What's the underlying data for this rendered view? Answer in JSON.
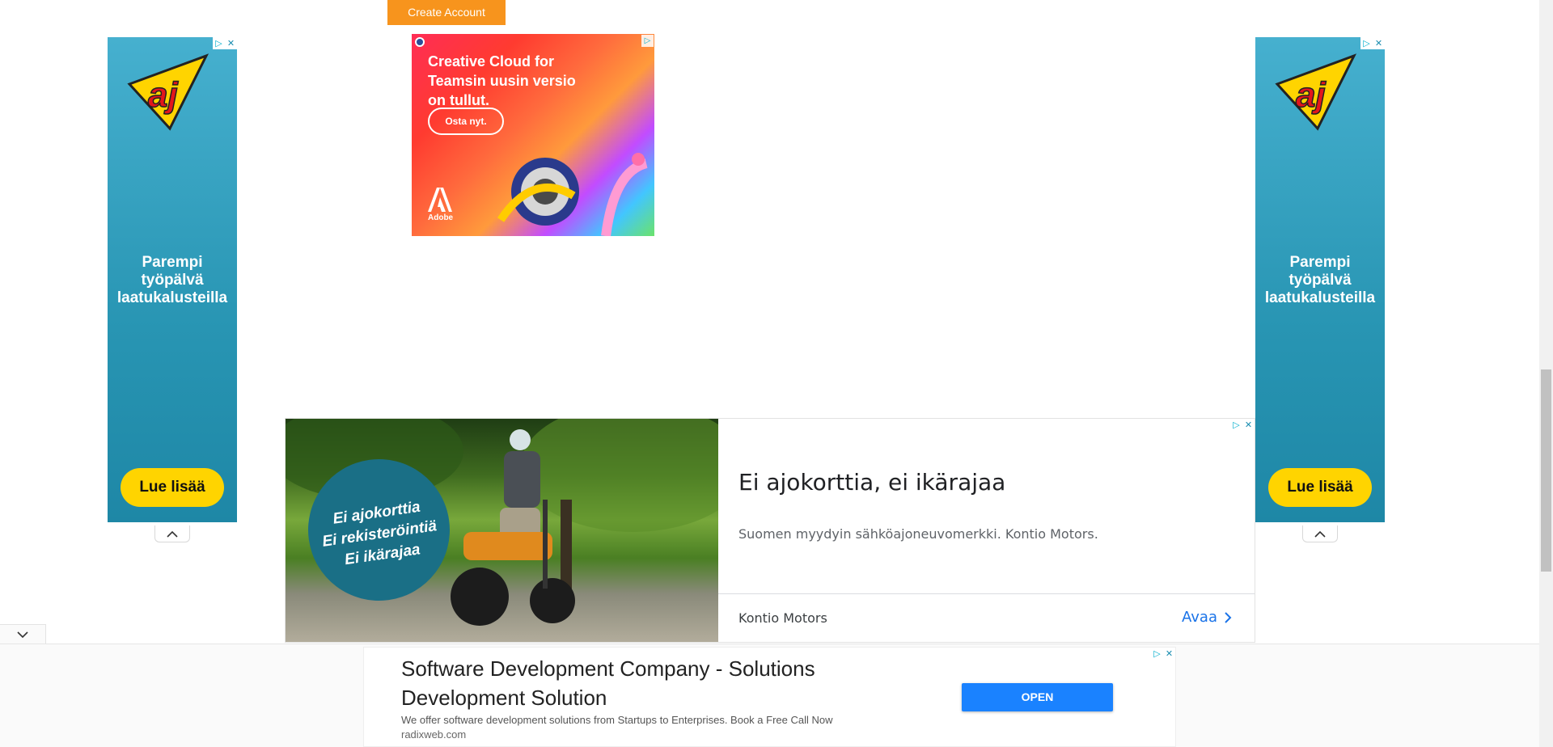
{
  "header": {
    "create_account_label": "Create Account"
  },
  "side_ads": {
    "tagline_line1": "Parempi",
    "tagline_line2": "työpälvä",
    "tagline_line3": "laatukalusteilla",
    "cta_label": "Lue lisää",
    "logo_text": "aj"
  },
  "adobe_ad": {
    "headline": "Creative Cloud for Teamsin uusin versio on tullut.",
    "cta_label": "Osta nyt.",
    "brand": "Adobe"
  },
  "kontio_ad": {
    "badge_line1": "Ei ajokorttia",
    "badge_line2": "Ei rekisteröintiä",
    "badge_line3": "Ei ikärajaa",
    "headline": "Ei ajokorttia, ei ikärajaa",
    "description": "Suomen myydyin sähköajoneuvomerkki. Kontio Motors.",
    "advertiser": "Kontio Motors",
    "open_label": "Avaa"
  },
  "bottom_ad": {
    "headline": "Software Development Company - Solutions Development Solution",
    "description": "We offer software development solutions from Startups to Enterprises. Book a Free Call Now",
    "url": "radixweb.com",
    "cta_label": "OPEN"
  },
  "icons": {
    "adchoices": "adchoices-icon",
    "close": "close-icon",
    "collapse": "chevron-up-icon",
    "expand": "chevron-down-icon"
  },
  "colors": {
    "accent_orange": "#f7941d",
    "aj_blue": "#2895b3",
    "aj_yellow": "#ffd400",
    "kontio_teal": "#1a6f86",
    "link_blue": "#1a73e8",
    "open_blue": "#1a82ff"
  }
}
